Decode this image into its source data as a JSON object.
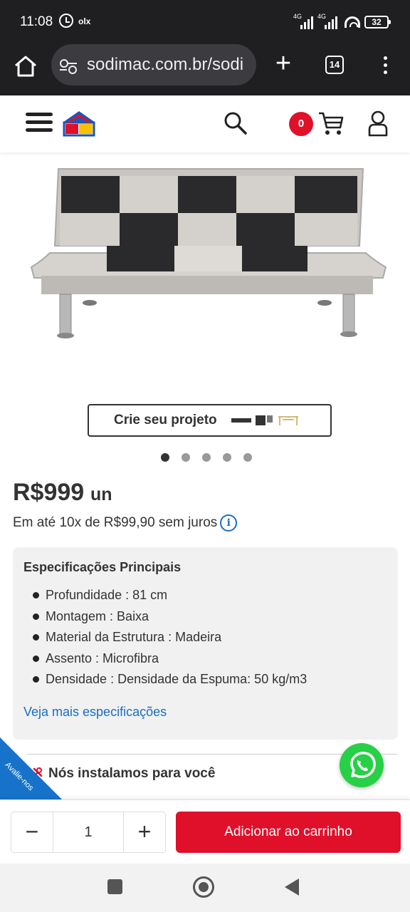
{
  "status": {
    "time": "11:08",
    "app_badge": "olx",
    "network_1": "4G",
    "network_2": "4G",
    "battery": "32"
  },
  "browser": {
    "url": "sodimac.com.br/sodi",
    "tab_count": "14"
  },
  "header": {
    "cart_count": "0",
    "brand_colors": {
      "red": "#e0102a",
      "blue": "#1a56b8",
      "yellow": "#f6c200"
    }
  },
  "gallery": {
    "project_button": "Crie seu projeto",
    "dot_count": 5,
    "active_dot": 0
  },
  "product": {
    "price": "R$999",
    "unit": "un",
    "installment": "Em até 10x de R$99,90 sem juros"
  },
  "specs": {
    "title": "Especificações Principais",
    "items": [
      "Profundidade : 81 cm",
      "Montagem : Baixa",
      "Material da Estrutura : Madeira",
      "Assento : Microfibra",
      "Densidade : Densidade da Espuma: 50 kg/m3"
    ],
    "more_link": "Veja mais especificações"
  },
  "install": {
    "text": "Nós instalamos para você"
  },
  "feedback_tab": "Avalie-nos",
  "cart_bar": {
    "quantity": "1",
    "minus": "−",
    "plus": "+",
    "add_button": "Adicionar ao carrinho"
  }
}
